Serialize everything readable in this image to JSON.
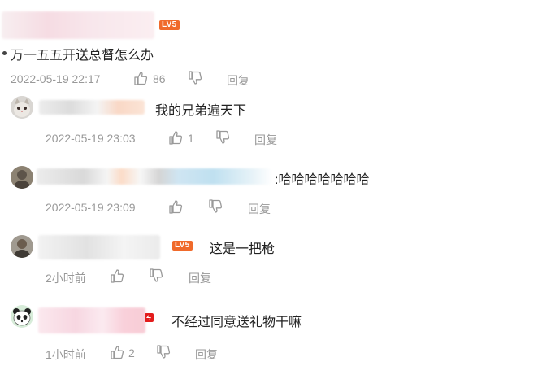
{
  "comments": [
    {
      "level_badge": "LV5",
      "text": "万一五五开送总督怎么办",
      "timestamp": "2022-05-19 22:17",
      "likes": "86",
      "reply_label": "回复"
    },
    {
      "text": "我的兄弟遍天下",
      "timestamp": "2022-05-19 23:03",
      "likes": "1",
      "reply_label": "回复"
    },
    {
      "text": ":哈哈哈哈哈哈哈",
      "timestamp": "2022-05-19 23:09",
      "likes": "",
      "reply_label": "回复"
    },
    {
      "level_badge": "LV5",
      "text": "这是一把枪",
      "timestamp": "2小时前",
      "likes": "",
      "reply_label": "回复"
    },
    {
      "text": "不经过同意送礼物干嘛",
      "timestamp": "1小时前",
      "likes": "2",
      "reply_label": "回复"
    }
  ],
  "colors": {
    "text": "#222222",
    "meta": "#999999",
    "level_badge": "#f06a2b",
    "red_badge": "#e31c1c"
  },
  "icons": [
    "thumb-up-icon",
    "thumb-down-icon",
    "bullet-icon",
    "avatar-icon",
    "red-badge-icon"
  ]
}
